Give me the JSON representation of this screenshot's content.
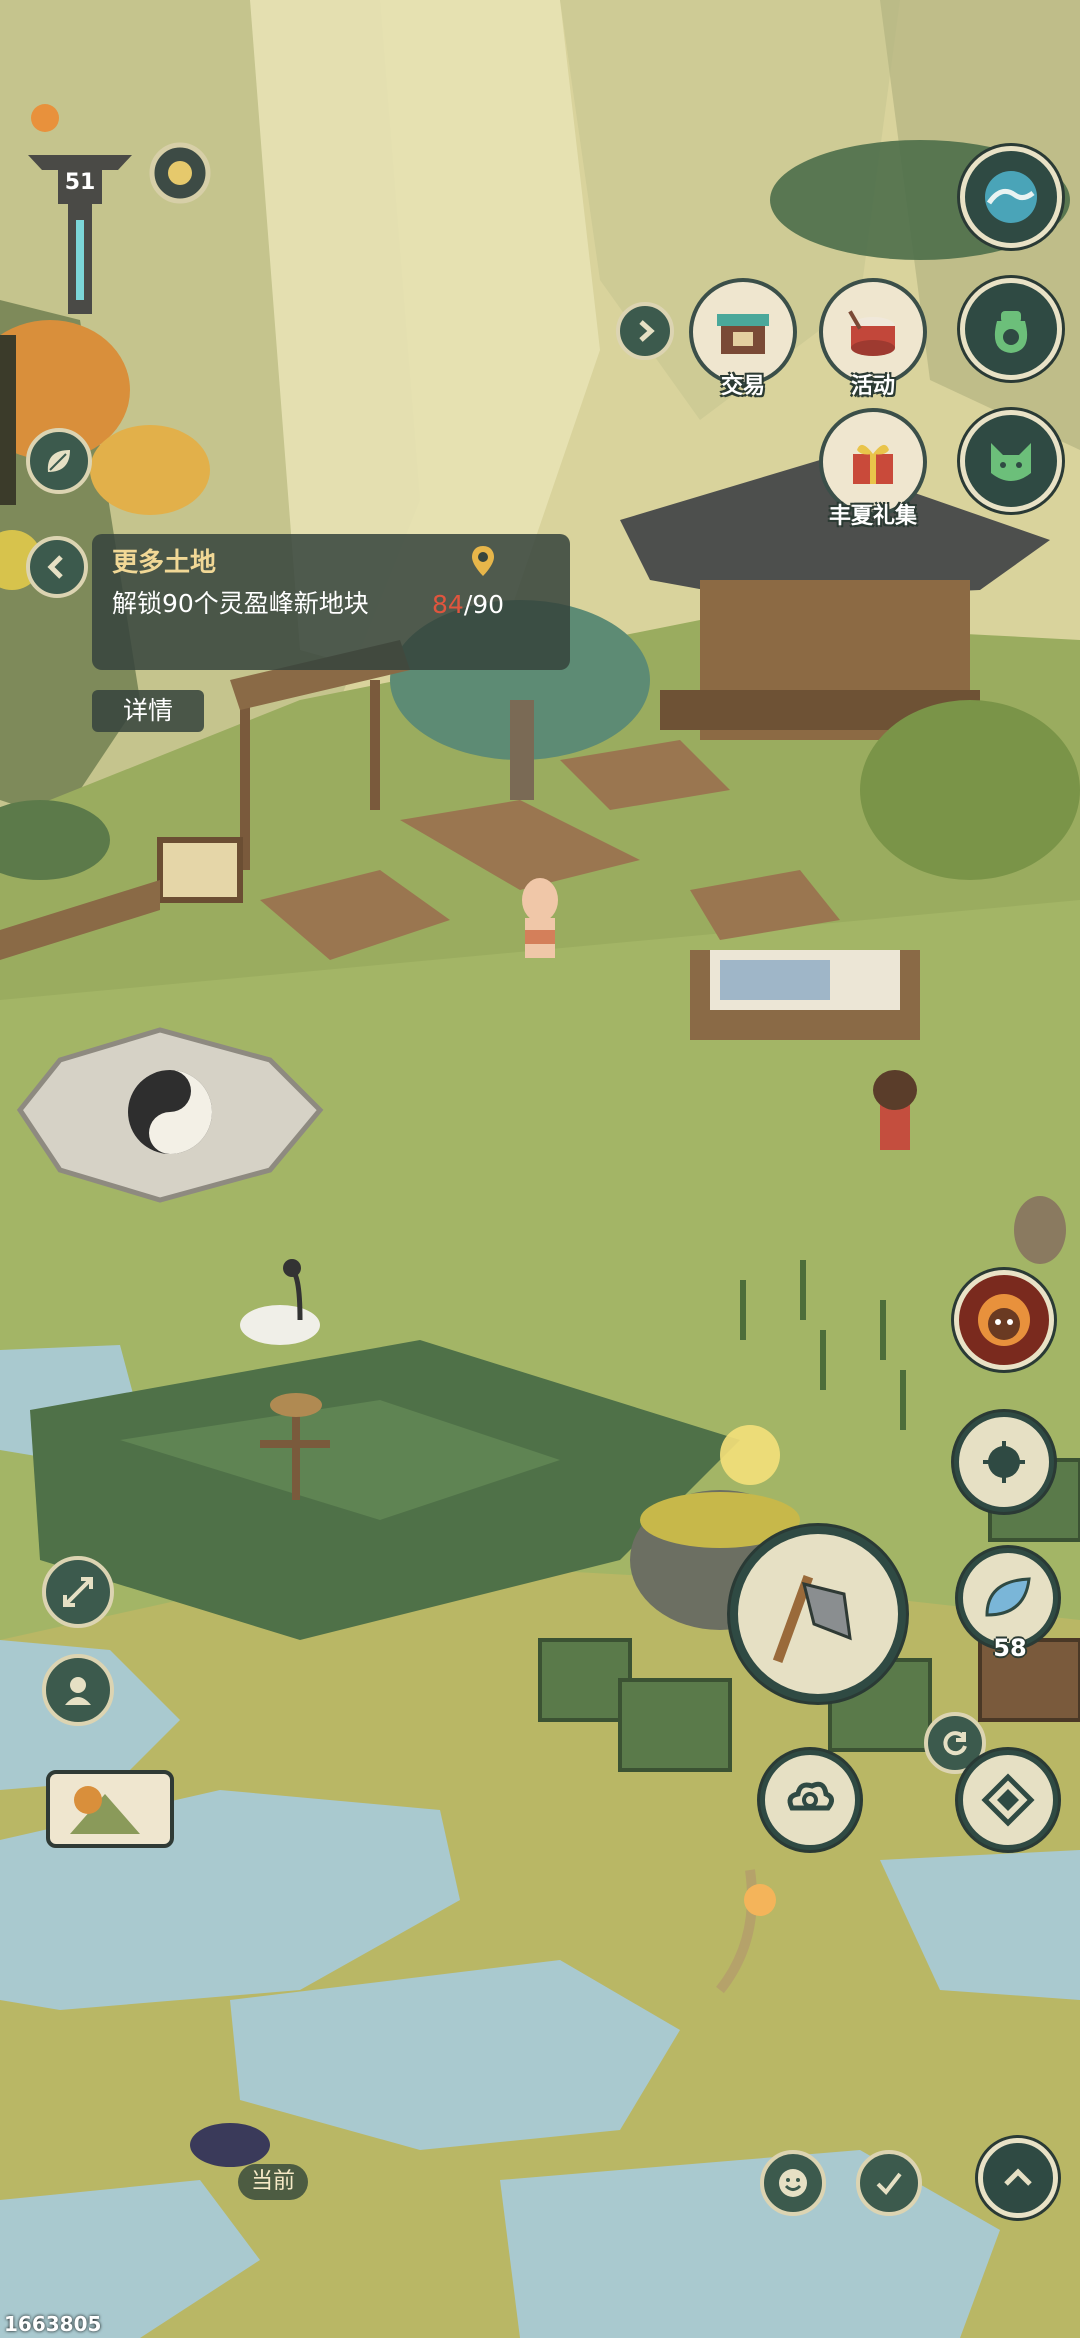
{
  "hud": {
    "level": "51"
  },
  "menu": {
    "trade_label": "交易",
    "event_label": "活动",
    "gift_label": "丰夏礼集"
  },
  "quest": {
    "title": "更多土地",
    "description": "解锁90个灵盈峰新地块",
    "progress_current": "84",
    "progress_total": "/90",
    "details_label": "详情"
  },
  "tools": {
    "leaf_count": "58"
  },
  "map": {
    "current_label": "当前"
  },
  "watermark": "1663805",
  "colors": {
    "panel": "#36443c",
    "button_dark": "#2f4a43",
    "button_rim": "#e9e2c6",
    "progress_red": "#e0553e",
    "title_gold": "#f1d896"
  }
}
